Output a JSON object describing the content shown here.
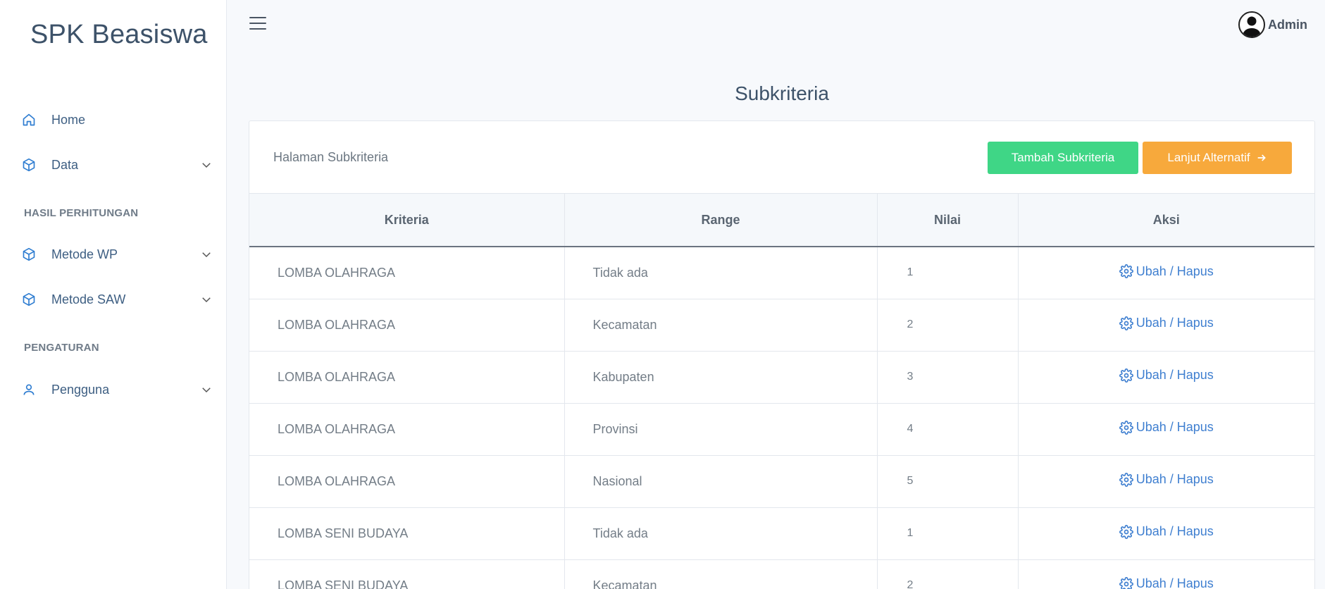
{
  "app": {
    "brand": "SPK Beasiswa"
  },
  "sidebar": {
    "items": [
      {
        "label": "Home",
        "icon": "home-icon",
        "has_chevron": false
      },
      {
        "label": "Data",
        "icon": "box-icon",
        "has_chevron": true
      }
    ],
    "sections": [
      {
        "title": "HASIL PERHITUNGAN",
        "items": [
          {
            "label": "Metode WP",
            "icon": "box-icon",
            "has_chevron": true
          },
          {
            "label": "Metode SAW",
            "icon": "box-icon",
            "has_chevron": true
          }
        ]
      },
      {
        "title": "PENGATURAN",
        "items": [
          {
            "label": "Pengguna",
            "icon": "user-icon",
            "has_chevron": true
          }
        ]
      }
    ]
  },
  "topbar": {
    "user_name": "Admin"
  },
  "page": {
    "title": "Subkriteria",
    "card_title": "Halaman Subkriteria",
    "btn_add": "Tambah Subkriteria",
    "btn_next": "Lanjut Alternatif"
  },
  "table": {
    "headers": [
      "Kriteria",
      "Range",
      "Nilai",
      "Aksi"
    ],
    "action_label": "Ubah / Hapus",
    "rows": [
      {
        "kriteria": "LOMBA OLAHRAGA",
        "range": "Tidak ada",
        "nilai": "1"
      },
      {
        "kriteria": "LOMBA OLAHRAGA",
        "range": "Kecamatan",
        "nilai": "2"
      },
      {
        "kriteria": "LOMBA OLAHRAGA",
        "range": "Kabupaten",
        "nilai": "3"
      },
      {
        "kriteria": "LOMBA OLAHRAGA",
        "range": "Provinsi",
        "nilai": "4"
      },
      {
        "kriteria": "LOMBA OLAHRAGA",
        "range": "Nasional",
        "nilai": "5"
      },
      {
        "kriteria": "LOMBA SENI BUDAYA",
        "range": "Tidak ada",
        "nilai": "1"
      },
      {
        "kriteria": "LOMBA SENI BUDAYA",
        "range": "Kecamatan",
        "nilai": "2"
      }
    ]
  },
  "colors": {
    "accent_green": "#3fd686",
    "accent_orange": "#f7a93c",
    "link_blue": "#3f7fd0"
  }
}
